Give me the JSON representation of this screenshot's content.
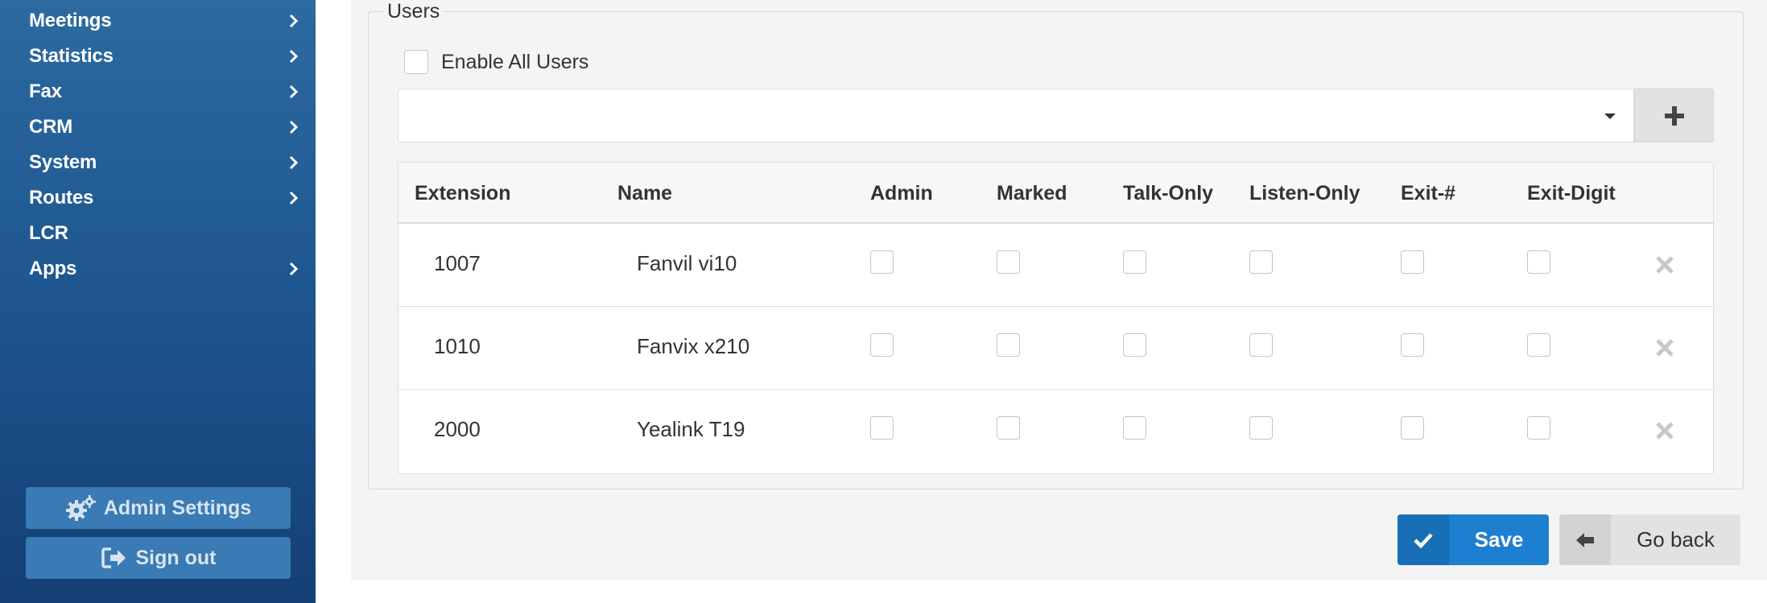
{
  "sidebar": {
    "items": [
      {
        "label": "Meetings",
        "has_submenu": true
      },
      {
        "label": "Statistics",
        "has_submenu": true
      },
      {
        "label": "Fax",
        "has_submenu": true
      },
      {
        "label": "CRM",
        "has_submenu": true
      },
      {
        "label": "System",
        "has_submenu": true
      },
      {
        "label": "Routes",
        "has_submenu": true
      },
      {
        "label": "LCR",
        "has_submenu": false
      },
      {
        "label": "Apps",
        "has_submenu": true
      }
    ],
    "admin_settings_label": "Admin Settings",
    "admin_settings_icon": "gears-icon",
    "sign_out_label": "Sign out",
    "sign_out_icon": "sign-out-icon"
  },
  "users": {
    "legend": "Users",
    "enable_all_label": "Enable All Users",
    "enable_all_checked": false,
    "select_value": "",
    "add_icon": "plus-icon",
    "columns": [
      "Extension",
      "Name",
      "Admin",
      "Marked",
      "Talk-Only",
      "Listen-Only",
      "Exit-#",
      "Exit-Digit"
    ],
    "rows": [
      {
        "extension": "1007",
        "name": "Fanvil vi10",
        "admin": false,
        "marked": false,
        "talk_only": false,
        "listen_only": false,
        "exit_hash": false,
        "exit_digit": false
      },
      {
        "extension": "1010",
        "name": "Fanvix x210",
        "admin": false,
        "marked": false,
        "talk_only": false,
        "listen_only": false,
        "exit_hash": false,
        "exit_digit": false
      },
      {
        "extension": "2000",
        "name": "Yealink T19",
        "admin": false,
        "marked": false,
        "talk_only": false,
        "listen_only": false,
        "exit_hash": false,
        "exit_digit": false
      }
    ],
    "delete_icon": "close-icon"
  },
  "actions": {
    "save_label": "Save",
    "save_icon": "check-icon",
    "back_label": "Go back",
    "back_icon": "arrow-left-icon"
  },
  "colors": {
    "sidebar_top": "#2c6aa0",
    "sidebar_bottom": "#143f75",
    "primary": "#1d7fd0",
    "content_bg": "#f4f4f4"
  }
}
